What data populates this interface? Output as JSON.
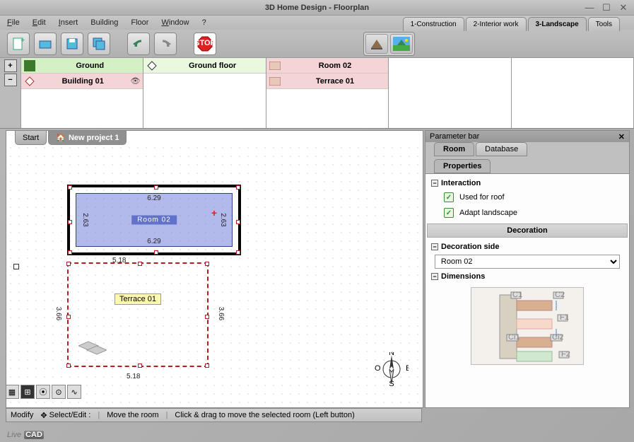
{
  "window": {
    "title": "3D Home Design - Floorplan"
  },
  "menu": {
    "file": "File",
    "edit": "Edit",
    "insert": "Insert",
    "building": "Building",
    "floor": "Floor",
    "window": "Window",
    "help": "?"
  },
  "mainTabs": {
    "t1": "1-Construction",
    "t2": "2-Interior work",
    "t3": "3-Landscape",
    "t4": "Tools"
  },
  "toolbar": {
    "stop": "STOP"
  },
  "outliner": {
    "col1": {
      "row1": "Ground",
      "row2": "Building 01"
    },
    "col2": {
      "row1": "Ground floor"
    },
    "col3": {
      "row1": "Room 02",
      "row2": "Terrace 01"
    }
  },
  "docTabs": {
    "t1": "Start",
    "t2": "New project 1"
  },
  "canvas": {
    "room02Label": "Room 02",
    "terraceLabel": "Terrace 01",
    "dims": {
      "d629": "6.29",
      "d263": "2.63",
      "d518": "5.18",
      "d366": "3.66"
    },
    "compass": {
      "n": "N",
      "s": "S",
      "e": "E",
      "o": "O"
    }
  },
  "statusbar": {
    "modify": "Modify",
    "select": "Select/Edit :",
    "move": "Move the room",
    "hint": "Click & drag to move the selected room (Left button)"
  },
  "panel": {
    "title": "Parameter bar",
    "tabs": {
      "room": "Room",
      "database": "Database",
      "properties": "Properties"
    },
    "sections": {
      "interaction": "Interaction",
      "decoration": "Decoration",
      "decorationSide": "Decoration side",
      "dimensions": "Dimensions"
    },
    "checks": {
      "roof": "Used for roof",
      "landscape": "Adapt landscape"
    },
    "decorationValue": "Room 02",
    "dimLabels": {
      "c1": "C1",
      "c2": "C2",
      "f1": "F1",
      "ci1": "Ci1",
      "ci2": "Ci2",
      "f2": "F2"
    }
  },
  "brand": {
    "live": "Live",
    "cad": "CAD"
  }
}
